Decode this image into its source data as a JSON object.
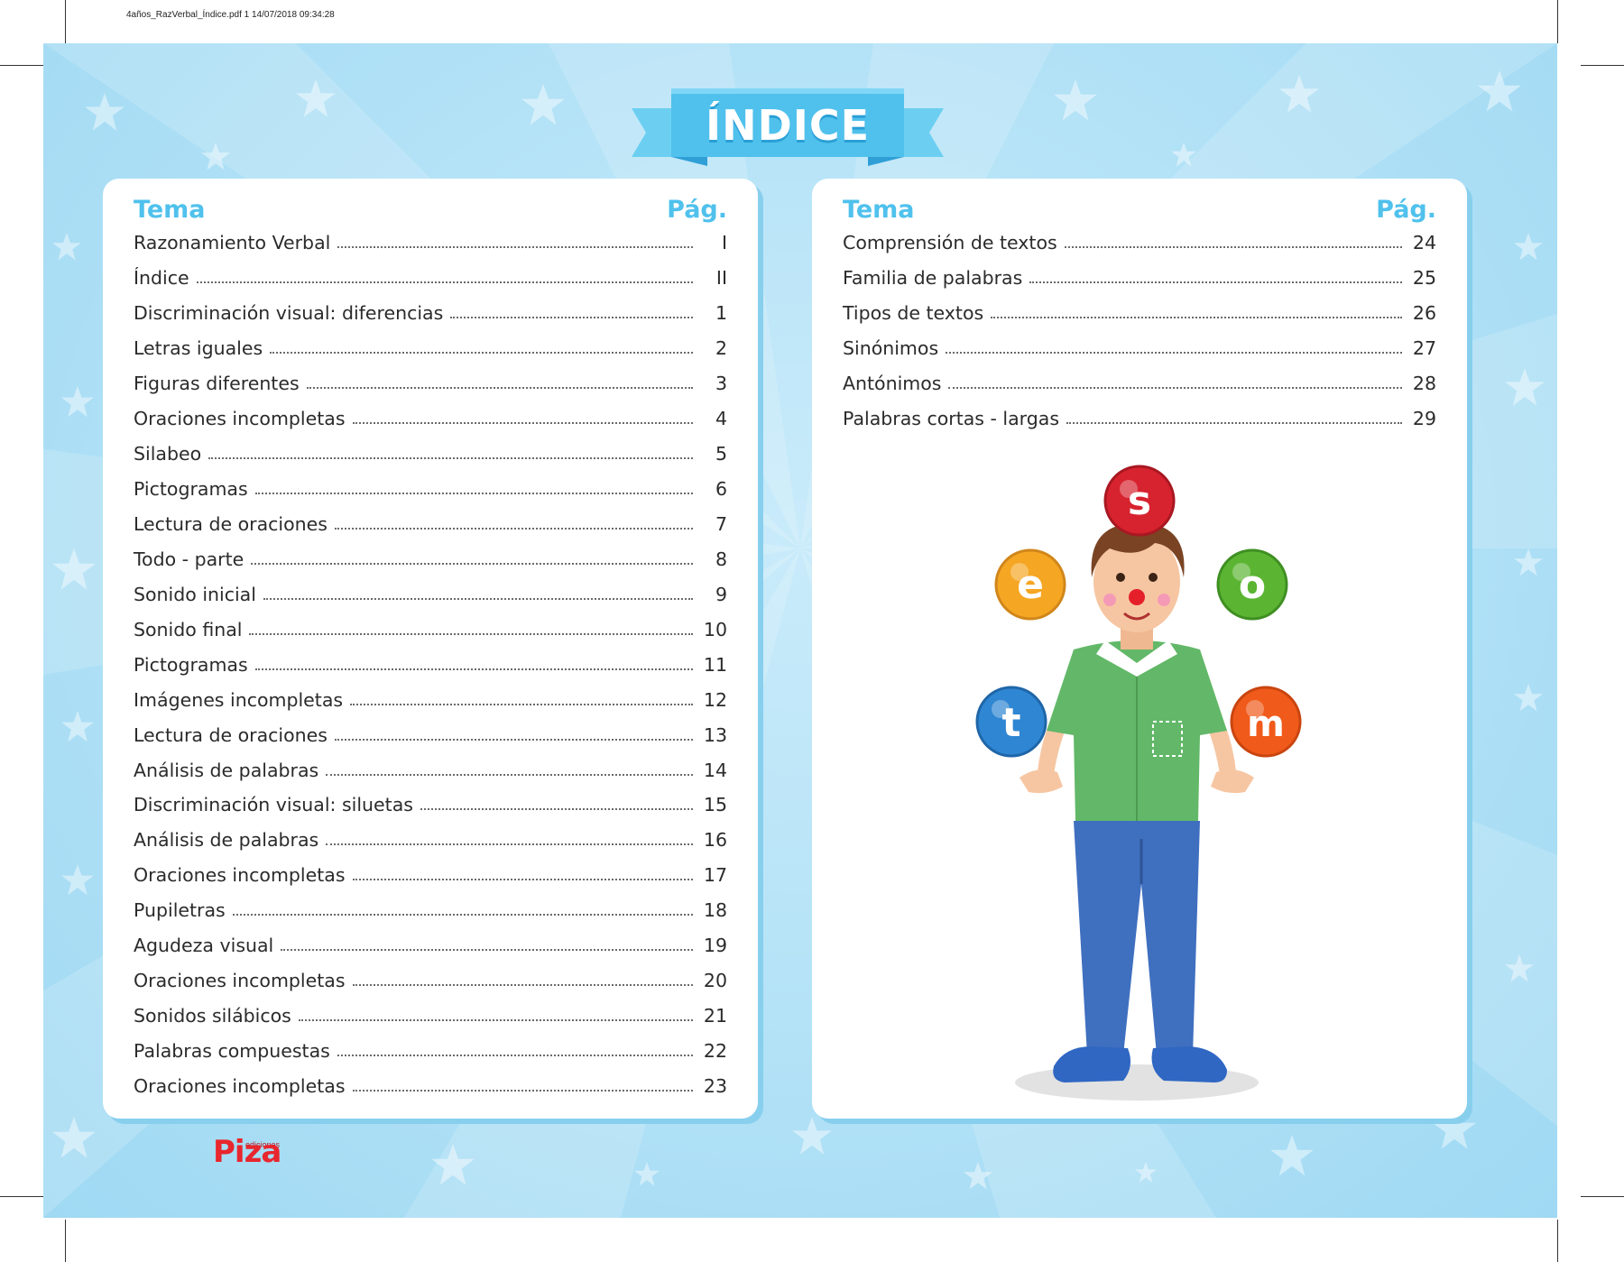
{
  "print_header": "4años_RazVerbal_Índice.pdf   1   14/07/2018   09:34:28",
  "title": "ÍNDICE",
  "left_table": {
    "header_topic": "Tema",
    "header_page": "Pág.",
    "rows": [
      {
        "topic": "Razonamiento Verbal",
        "page": "I"
      },
      {
        "topic": "Índice",
        "page": "II"
      },
      {
        "topic": "Discriminación visual: diferencias",
        "page": "1"
      },
      {
        "topic": "Letras iguales",
        "page": "2"
      },
      {
        "topic": "Figuras diferentes",
        "page": "3"
      },
      {
        "topic": "Oraciones incompletas",
        "page": "4"
      },
      {
        "topic": "Silabeo",
        "page": "5"
      },
      {
        "topic": "Pictogramas",
        "page": "6"
      },
      {
        "topic": "Lectura de oraciones",
        "page": "7"
      },
      {
        "topic": "Todo - parte",
        "page": "8"
      },
      {
        "topic": "Sonido inicial",
        "page": "9"
      },
      {
        "topic": "Sonido final",
        "page": "10"
      },
      {
        "topic": "Pictogramas",
        "page": "11"
      },
      {
        "topic": "Imágenes incompletas",
        "page": "12"
      },
      {
        "topic": "Lectura de oraciones",
        "page": "13"
      },
      {
        "topic": "Análisis de palabras",
        "page": "14"
      },
      {
        "topic": "Discriminación visual: siluetas",
        "page": "15"
      },
      {
        "topic": "Análisis de palabras",
        "page": "16"
      },
      {
        "topic": "Oraciones incompletas",
        "page": "17"
      },
      {
        "topic": "Pupiletras",
        "page": "18"
      },
      {
        "topic": "Agudeza visual",
        "page": "19"
      },
      {
        "topic": "Oraciones incompletas",
        "page": "20"
      },
      {
        "topic": "Sonidos silábicos",
        "page": "21"
      },
      {
        "topic": "Palabras compuestas",
        "page": "22"
      },
      {
        "topic": "Oraciones incompletas",
        "page": "23"
      }
    ]
  },
  "right_table": {
    "header_topic": "Tema",
    "header_page": "Pág.",
    "rows": [
      {
        "topic": "Comprensión de textos",
        "page": "24"
      },
      {
        "topic": "Familia de palabras",
        "page": "25"
      },
      {
        "topic": "Tipos de textos",
        "page": "26"
      },
      {
        "topic": "Sinónimos",
        "page": "27"
      },
      {
        "topic": "Antónimos",
        "page": "28"
      },
      {
        "topic": "Palabras cortas - largas",
        "page": "29"
      }
    ]
  },
  "juggling_letters": [
    {
      "letter": "s",
      "color": "#d7232f"
    },
    {
      "letter": "e",
      "color": "#f5a623"
    },
    {
      "letter": "o",
      "color": "#5bb532"
    },
    {
      "letter": "t",
      "color": "#2f86d2"
    },
    {
      "letter": "m",
      "color": "#f05a1a"
    }
  ],
  "publisher": {
    "small": "ediciones",
    "name": "Piza"
  },
  "colors": {
    "background": "#b6e3f7",
    "accent": "#4fc1ec",
    "brand": "#e8262e"
  }
}
